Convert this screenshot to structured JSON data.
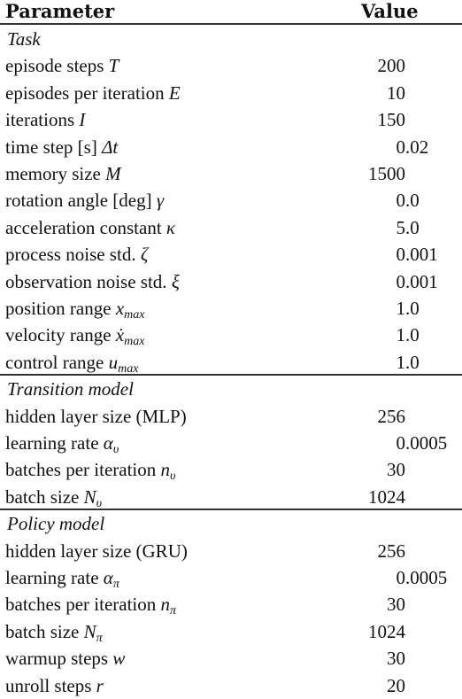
{
  "header": {
    "parameter": "Parameter",
    "value": "Value"
  },
  "sections": [
    {
      "title": "Task",
      "rows": [
        {
          "label": "episode steps ",
          "sym": "T",
          "sub": "",
          "int": "200",
          "frac": ""
        },
        {
          "label": "episodes per iteration ",
          "sym": "E",
          "sub": "",
          "int": "10",
          "frac": ""
        },
        {
          "label": "iterations ",
          "sym": "I",
          "sub": "",
          "int": "150",
          "frac": ""
        },
        {
          "label": "time step [s] ",
          "sym": "Δt",
          "sub": "",
          "int": "0",
          "frac": ".02"
        },
        {
          "label": "memory size ",
          "sym": "M",
          "sub": "",
          "int": "1500",
          "frac": ""
        },
        {
          "label": "rotation angle [deg] ",
          "sym": "γ",
          "sub": "",
          "int": "0",
          "frac": ".0"
        },
        {
          "label": "acceleration constant ",
          "sym": "κ",
          "sub": "",
          "int": "5",
          "frac": ".0"
        },
        {
          "label": "process noise std. ",
          "sym": "ζ",
          "sub": "",
          "int": "0",
          "frac": ".001"
        },
        {
          "label": "observation noise std. ",
          "sym": "ξ",
          "sub": "",
          "int": "0",
          "frac": ".001"
        },
        {
          "label": "position range ",
          "sym": "x",
          "sub": "max",
          "int": "1",
          "frac": ".0"
        },
        {
          "label": "velocity range ",
          "sym": "ẋ",
          "sub": "max",
          "int": "1",
          "frac": ".0"
        },
        {
          "label": "control range ",
          "sym": "u",
          "sub": "max",
          "int": "1",
          "frac": ".0"
        }
      ]
    },
    {
      "title": "Transition model",
      "rows": [
        {
          "label": "hidden layer size (MLP)",
          "sym": "",
          "sub": "",
          "int": "256",
          "frac": ""
        },
        {
          "label": "learning rate ",
          "sym": "α",
          "sub": "υ",
          "int": "0",
          "frac": ".0005"
        },
        {
          "label": "batches per iteration ",
          "sym": "n",
          "sub": "υ",
          "int": "30",
          "frac": ""
        },
        {
          "label": "batch size ",
          "sym": "N",
          "sub": "υ",
          "int": "1024",
          "frac": ""
        }
      ]
    },
    {
      "title": "Policy model",
      "rows": [
        {
          "label": "hidden layer size (GRU)",
          "sym": "",
          "sub": "",
          "int": "256",
          "frac": ""
        },
        {
          "label": "learning rate ",
          "sym": "α",
          "sub": "π",
          "int": "0",
          "frac": ".0005"
        },
        {
          "label": "batches per iteration ",
          "sym": "n",
          "sub": "π",
          "int": "30",
          "frac": ""
        },
        {
          "label": "batch size ",
          "sym": "N",
          "sub": "π",
          "int": "1024",
          "frac": ""
        },
        {
          "label": "warmup steps ",
          "sym": "w",
          "sub": "",
          "int": "30",
          "frac": ""
        },
        {
          "label": "unroll steps ",
          "sym": "r",
          "sub": "",
          "int": "20",
          "frac": ""
        }
      ]
    }
  ]
}
